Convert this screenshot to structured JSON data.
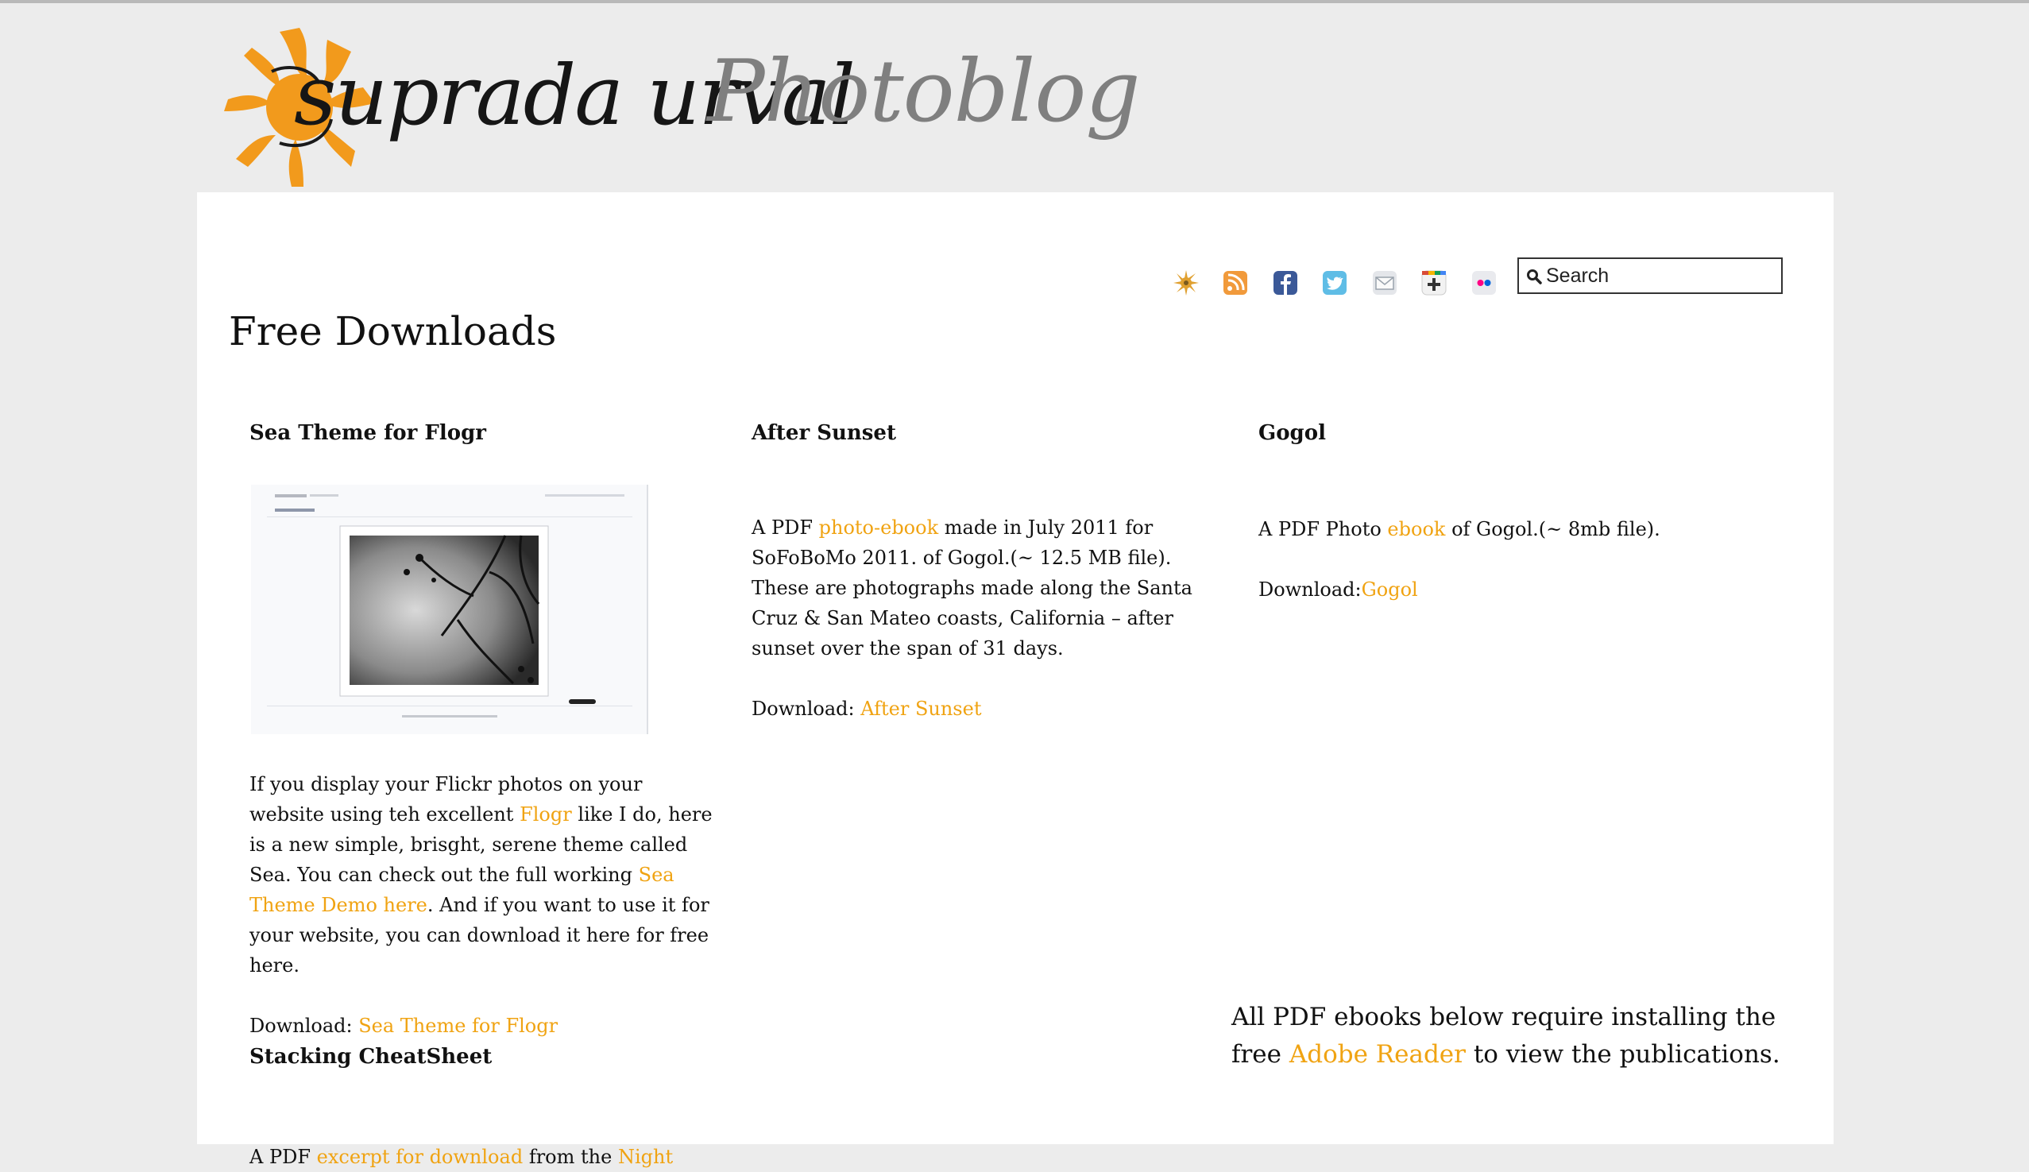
{
  "site": {
    "logo_name": "suprada urval",
    "logo_suffix": "Photoblog"
  },
  "toolbar": {
    "icons": [
      "sun-badge-icon",
      "rss-icon",
      "facebook-icon",
      "twitter-icon",
      "email-icon",
      "google-plus-icon",
      "flickr-icon"
    ],
    "search_placeholder": "Search"
  },
  "page": {
    "title": "Free Downloads"
  },
  "items": [
    {
      "heading": "Sea Theme for Flogr",
      "p1": [
        "If you display your Flickr photos on your website using teh excellent ",
        "Flogr",
        " like I do, here is a new simple, brisght, serene theme called Sea. You can check out the full working ",
        "Sea Theme Demo here",
        ". And if you want to use it for your website, you can download it here for free here."
      ],
      "download_label": "Download: ",
      "download_link": "Sea Theme for Flogr"
    },
    {
      "heading": "After Sunset",
      "p1": [
        "A PDF ",
        "photo-ebook",
        " made in July 2011 for SoFoBoMo 2011. of Gogol.(~ 12.5 MB file). These are photographs made along the Santa Cruz & San Mateo coasts, California – after sunset over the span of 31 days."
      ],
      "download_label": "Download: ",
      "download_link": "After Sunset"
    },
    {
      "heading": "Gogol",
      "p1": [
        "A PDF Photo ",
        "ebook",
        " of Gogol.(~ 8mb file)."
      ],
      "download_label": "Download:",
      "download_link": "Gogol"
    },
    {
      "heading": "Stacking CheatSheet",
      "p1": [
        "A PDF ",
        "excerpt for download",
        " from the ",
        "Night"
      ]
    }
  ],
  "note": {
    "text_before": "All PDF ebooks below require installing the free ",
    "link": "Adobe Reader",
    "text_after": " to view the publications."
  },
  "colors": {
    "link": "#f0a312",
    "page_bg": "#ececec",
    "panel_bg": "#ffffff"
  }
}
